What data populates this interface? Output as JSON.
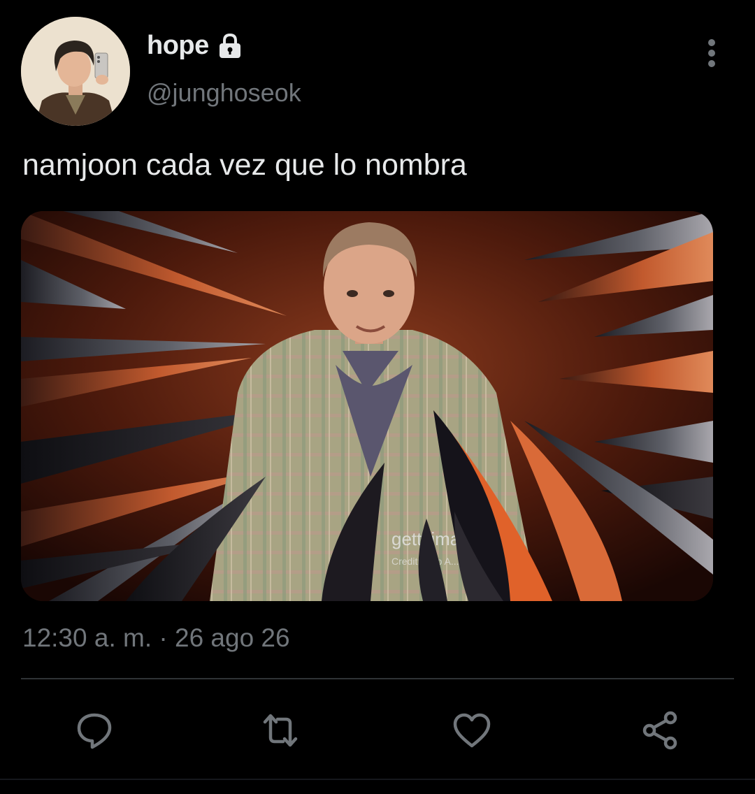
{
  "tweet": {
    "display_name": "hope",
    "handle": "@junghoseok",
    "protected_icon": "lock-icon",
    "text": "namjoon cada vez que lo nombra",
    "timestamp": "12:30 a. m. · 26 ago 26",
    "media": {
      "watermark": "gettyimages",
      "watermark_credit": "Credit: ... to A..."
    }
  },
  "actions": {
    "reply_icon": "speech-bubble-icon",
    "retweet_icon": "retweet-arrows-icon",
    "like_icon": "heart-icon",
    "share_icon": "share-icon",
    "more_icon": "vertical-dots-icon"
  },
  "colors": {
    "background": "#000000",
    "primary_text": "#e7e9ea",
    "secondary_text": "#71767b",
    "divider": "#2f3336"
  }
}
